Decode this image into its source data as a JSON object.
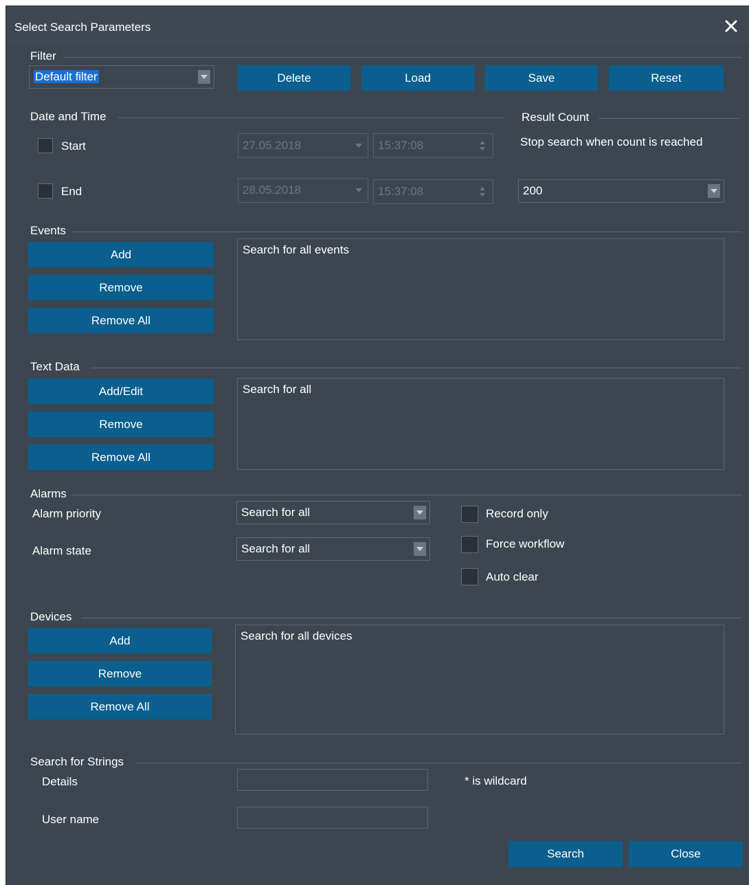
{
  "window": {
    "title": "Select Search Parameters"
  },
  "filter": {
    "section": "Filter",
    "selected": "Default filter",
    "buttons": {
      "delete": "Delete",
      "load": "Load",
      "save": "Save",
      "reset": "Reset"
    }
  },
  "date_time": {
    "section": "Date and Time",
    "start": {
      "label": "Start",
      "checked": false,
      "date": "27.05.2018",
      "time": "15:37:08"
    },
    "end": {
      "label": "End",
      "checked": false,
      "date": "28.05.2018",
      "time": "15:37:08"
    }
  },
  "result_count": {
    "section": "Result Count",
    "description": "Stop search when count is reached",
    "value": "200"
  },
  "events": {
    "section": "Events",
    "buttons": {
      "add": "Add",
      "remove": "Remove",
      "remove_all": "Remove All"
    },
    "list_text": "Search for all events"
  },
  "text_data": {
    "section": "Text Data",
    "buttons": {
      "add_edit": "Add/Edit",
      "remove": "Remove",
      "remove_all": "Remove All"
    },
    "list_text": "Search for all"
  },
  "alarms": {
    "section": "Alarms",
    "priority_label": "Alarm priority",
    "priority_value": "Search for all",
    "state_label": "Alarm state",
    "state_value": "Search for all",
    "record_only": "Record only",
    "force_workflow": "Force workflow",
    "auto_clear": "Auto clear"
  },
  "devices": {
    "section": "Devices",
    "buttons": {
      "add": "Add",
      "remove": "Remove",
      "remove_all": "Remove All"
    },
    "list_text": "Search for all devices"
  },
  "strings": {
    "section": "Search for Strings",
    "details_label": "Details",
    "details_value": "",
    "wildcard_hint": "* is wildcard",
    "user_label": "User name",
    "user_value": ""
  },
  "footer": {
    "search": "Search",
    "close": "Close"
  },
  "colors": {
    "background": "#3c4650",
    "button": "#0a5f8e",
    "selection": "#1c6fd1"
  }
}
